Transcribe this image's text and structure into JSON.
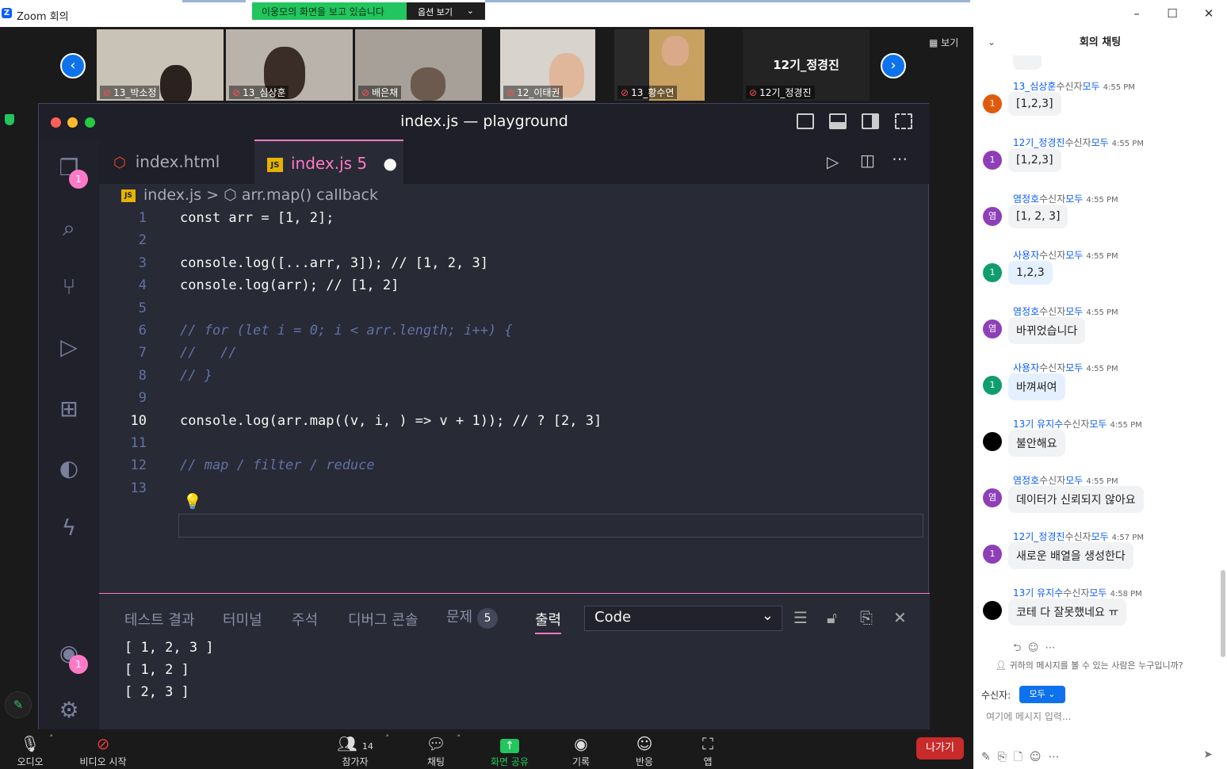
{
  "window": {
    "title": "Zoom 회의",
    "logo": "Z"
  },
  "share_banner": {
    "text": "이웅모의 화면을 보고 있습니다",
    "options": "옵션 보기"
  },
  "gallery": {
    "view": "보기",
    "participants": [
      {
        "name": "13_박소정"
      },
      {
        "name": "13_심상훈"
      },
      {
        "name": "배은채"
      },
      {
        "name": "12_이태권"
      },
      {
        "name": "13_황수연"
      },
      {
        "name": "12기_정경진",
        "title": "12기_정경진"
      }
    ]
  },
  "vscode": {
    "title": "index.js — playground",
    "tabs": [
      {
        "label": "index.html",
        "icon": "html5-icon"
      },
      {
        "label": "index.js",
        "count": "5",
        "icon": "js-icon"
      }
    ],
    "breadcrumb": {
      "file": "index.js",
      "sep": ">",
      "symbol": "arr.map() callback"
    },
    "activity_badges": {
      "explorer": "1",
      "account": "1"
    },
    "lines": [
      {
        "n": "1",
        "code": "const arr = [1, 2];"
      },
      {
        "n": "2",
        "code": ""
      },
      {
        "n": "3",
        "code": "console.log([...arr, 3]); // [1, 2, 3]"
      },
      {
        "n": "4",
        "code": "console.log(arr); // [1, 2]"
      },
      {
        "n": "5",
        "code": ""
      },
      {
        "n": "6",
        "code": "// for (let i = 0; i < arr.length; i++) {"
      },
      {
        "n": "7",
        "code": "//   //"
      },
      {
        "n": "8",
        "code": "// }"
      },
      {
        "n": "9",
        "code": ""
      },
      {
        "n": "10",
        "code": "console.log(arr.map((v, i, ) => v + 1)); // ? [2, 3]"
      },
      {
        "n": "11",
        "code": ""
      },
      {
        "n": "12",
        "code": "// map / filter / reduce"
      },
      {
        "n": "13",
        "code": ""
      }
    ],
    "panel": {
      "tabs": [
        "테스트 결과",
        "터미널",
        "주석",
        "디버그 콘솔",
        "문제",
        "출력"
      ],
      "problem_count": "5",
      "select": "Code",
      "output": [
        "[ 1, 2, 3 ]",
        "[ 1, 2 ]",
        "[ 2, 3 ]"
      ]
    }
  },
  "toolbar": {
    "audio": "오디오",
    "video": "비디오 시작",
    "participants": "참가자",
    "participant_count": "14",
    "chat": "채팅",
    "share": "화면 공유",
    "record": "기록",
    "reactions": "반응",
    "apps": "앱",
    "leave": "나가기"
  },
  "chat": {
    "header": "회의 채팅",
    "messages": [
      {
        "sender": "13_심상훈",
        "to": "수신자",
        "target": "모두",
        "time": "4:55 PM",
        "text": "[1,2,3]",
        "avatar": "1",
        "color": "#e05a0c"
      },
      {
        "sender": "12기_정경진",
        "to": "수신자",
        "target": "모두",
        "time": "4:55 PM",
        "text": "[1,2,3]",
        "avatar": "1",
        "color": "#8e3fb8"
      },
      {
        "sender": "염정호",
        "to": "수신자",
        "target": "모두",
        "time": "4:55 PM",
        "text": "[1, 2, 3]",
        "avatar": "염",
        "color": "#8e3fb8"
      },
      {
        "sender": "사용자",
        "to": "수신자",
        "target": "모두",
        "time": "4:55 PM",
        "text": "1,2,3",
        "avatar": "1",
        "color": "#0f9d6e",
        "mine": true
      },
      {
        "sender": "염정호",
        "to": "수신자",
        "target": "모두",
        "time": "4:55 PM",
        "text": "바뀌었습니다",
        "avatar": "염",
        "color": "#8e3fb8"
      },
      {
        "sender": "사용자",
        "to": "수신자",
        "target": "모두",
        "time": "4:55 PM",
        "text": "바껴써여",
        "avatar": "1",
        "color": "#0f9d6e",
        "mine": true
      },
      {
        "sender": "13기 유지수",
        "to": "수신자",
        "target": "모두",
        "time": "4:55 PM",
        "text": "불안해요",
        "avatar": "",
        "color": "#000000"
      },
      {
        "sender": "염정호",
        "to": "수신자",
        "target": "모두",
        "time": "4:55 PM",
        "text": "데이터가 신뢰되지 않아요",
        "avatar": "염",
        "color": "#8e3fb8"
      },
      {
        "sender": "12기_정경진",
        "to": "수신자",
        "target": "모두",
        "time": "4:57 PM",
        "text": "새로운 배열을 생성한다",
        "avatar": "1",
        "color": "#8e3fb8"
      },
      {
        "sender": "13기 유지수",
        "to": "수신자",
        "target": "모두",
        "time": "4:58 PM",
        "text": "코테 다 잘못했네요 ㅠ",
        "avatar": "",
        "color": "#000000"
      }
    ],
    "who_can_see": "귀하의 메시지를 볼 수 있는 사람은 누구입니까?",
    "to_label": "수신자:",
    "to_value": "모두",
    "input_placeholder": "여기에 메시지 입력..."
  }
}
